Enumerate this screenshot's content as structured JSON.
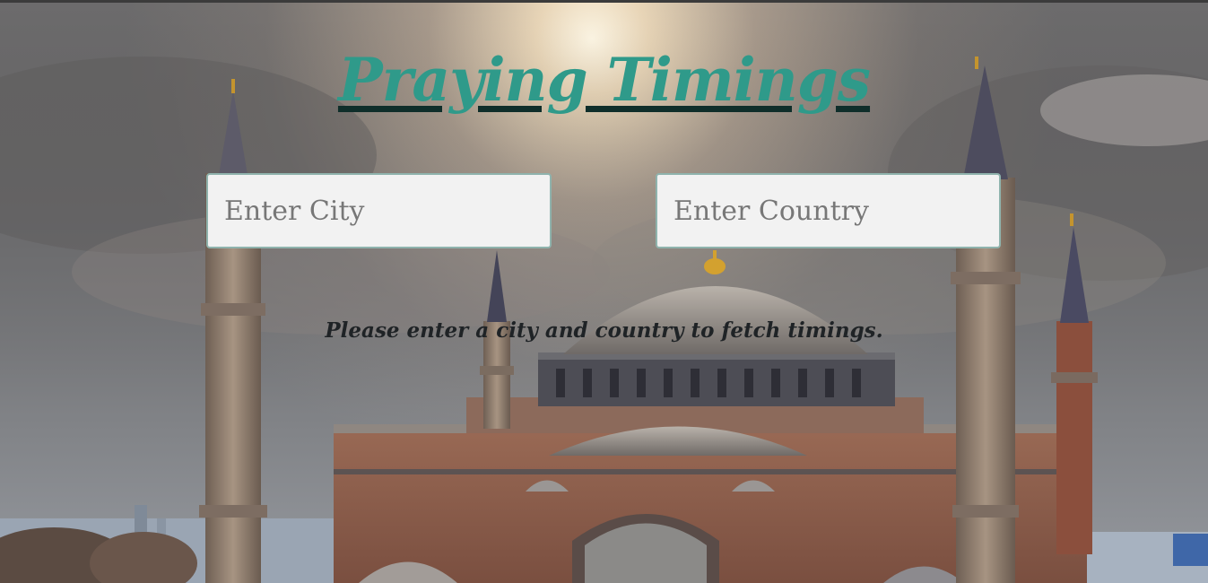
{
  "page": {
    "title": "Praying Timings",
    "city_input": {
      "placeholder": "Enter City",
      "value": ""
    },
    "country_input": {
      "placeholder": "Enter Country",
      "value": ""
    },
    "status_message": "Please enter a city and country to fetch timings."
  },
  "theme": {
    "title_color": "#2f9a8a",
    "underline_color": "#0f2e2a",
    "input_background": "#f2f2f2",
    "message_color": "#1f2326"
  },
  "background": {
    "subject": "mosque-with-domes-and-minarets",
    "sky": "cloudy-sunset"
  }
}
